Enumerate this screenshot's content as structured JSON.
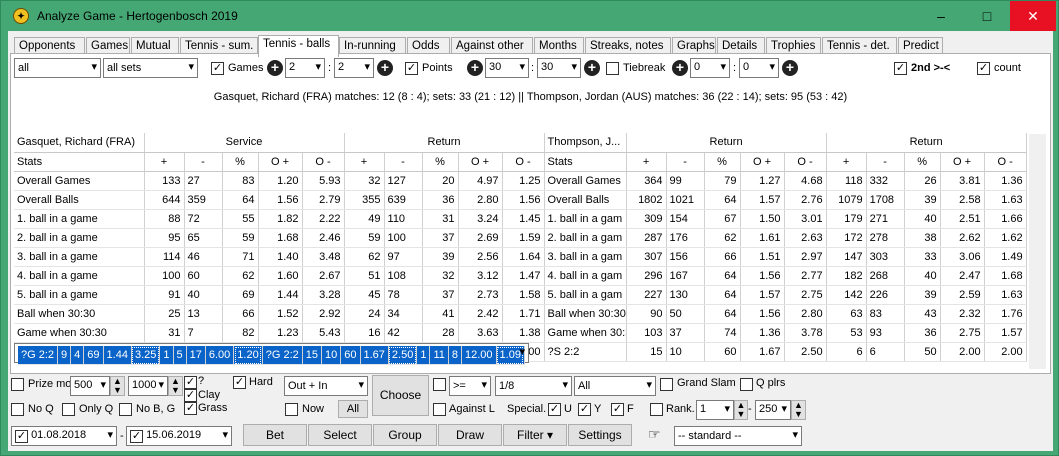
{
  "window": {
    "title": "Analyze Game - Hertogenbosch 2019",
    "minimize": "–",
    "maximize": "□",
    "close": "✕"
  },
  "tabs": [
    "Opponents",
    "Games",
    "Mutual",
    "Tennis - sum.",
    "Tennis - balls",
    "In-running",
    "Odds",
    "Against other",
    "Months",
    "Streaks, notes",
    "Graphs",
    "Details",
    "Trophies",
    "Tennis - det.",
    "Predict"
  ],
  "filters": {
    "all": "all",
    "sets": "all sets",
    "games_label": "Games",
    "games_a": "2",
    "games_b": "2",
    "points_label": "Points",
    "points_a": "30",
    "points_b": "30",
    "tiebreak_label": "Tiebreak",
    "tb_a": "0",
    "tb_b": "0",
    "second_label": "2nd >-<",
    "count_label": "count"
  },
  "summary": "Gasquet, Richard (FRA)  matches: 12 (8 : 4);  sets: 33 (21 : 12)   ||   Thompson, Jordan (AUS)  matches: 36 (22 : 14);  sets: 95 (53 : 42)",
  "header": {
    "p1": "Gasquet, Richard (FRA)",
    "service": "Service",
    "return": "Return",
    "p2": "Thompson, J...",
    "return2": "Return",
    "return3": "Return",
    "stats": "Stats",
    "cols": [
      "+",
      "-",
      "%",
      "O +",
      "O -"
    ]
  },
  "rows": [
    {
      "name": "Overall Games",
      "a": [
        "133",
        "27",
        "83",
        "1.20",
        "5.93"
      ],
      "b": [
        "32",
        "127",
        "20",
        "4.97",
        "1.25"
      ],
      "name2": "Overall Games",
      "c": [
        "364",
        "99",
        "79",
        "1.27",
        "4.68"
      ],
      "d": [
        "118",
        "332",
        "26",
        "3.81",
        "1.36"
      ]
    },
    {
      "name": "Overall Balls",
      "a": [
        "644",
        "359",
        "64",
        "1.56",
        "2.79"
      ],
      "b": [
        "355",
        "639",
        "36",
        "2.80",
        "1.56"
      ],
      "name2": "Overall Balls",
      "c": [
        "1802",
        "1021",
        "64",
        "1.57",
        "2.76"
      ],
      "d": [
        "1079",
        "1708",
        "39",
        "2.58",
        "1.63"
      ]
    },
    {
      "name": "1. ball in a game",
      "a": [
        "88",
        "72",
        "55",
        "1.82",
        "2.22"
      ],
      "b": [
        "49",
        "110",
        "31",
        "3.24",
        "1.45"
      ],
      "name2": "1. ball in a gam",
      "c": [
        "309",
        "154",
        "67",
        "1.50",
        "3.01"
      ],
      "d": [
        "179",
        "271",
        "40",
        "2.51",
        "1.66"
      ]
    },
    {
      "name": "2. ball in a game",
      "a": [
        "95",
        "65",
        "59",
        "1.68",
        "2.46"
      ],
      "b": [
        "59",
        "100",
        "37",
        "2.69",
        "1.59"
      ],
      "name2": "2. ball in a gam",
      "c": [
        "287",
        "176",
        "62",
        "1.61",
        "2.63"
      ],
      "d": [
        "172",
        "278",
        "38",
        "2.62",
        "1.62"
      ]
    },
    {
      "name": "3. ball in a game",
      "a": [
        "114",
        "46",
        "71",
        "1.40",
        "3.48"
      ],
      "b": [
        "62",
        "97",
        "39",
        "2.56",
        "1.64"
      ],
      "name2": "3. ball in a gam",
      "c": [
        "307",
        "156",
        "66",
        "1.51",
        "2.97"
      ],
      "d": [
        "147",
        "303",
        "33",
        "3.06",
        "1.49"
      ]
    },
    {
      "name": "4. ball in a game",
      "a": [
        "100",
        "60",
        "62",
        "1.60",
        "2.67"
      ],
      "b": [
        "51",
        "108",
        "32",
        "3.12",
        "1.47"
      ],
      "name2": "4. ball in a gam",
      "c": [
        "296",
        "167",
        "64",
        "1.56",
        "2.77"
      ],
      "d": [
        "182",
        "268",
        "40",
        "2.47",
        "1.68"
      ]
    },
    {
      "name": "5. ball in a game",
      "a": [
        "91",
        "40",
        "69",
        "1.44",
        "3.28"
      ],
      "b": [
        "45",
        "78",
        "37",
        "2.73",
        "1.58"
      ],
      "name2": "5. ball in a gam",
      "c": [
        "227",
        "130",
        "64",
        "1.57",
        "2.75"
      ],
      "d": [
        "142",
        "226",
        "39",
        "2.59",
        "1.63"
      ]
    },
    {
      "name": "Ball when 30:30",
      "a": [
        "25",
        "13",
        "66",
        "1.52",
        "2.92"
      ],
      "b": [
        "24",
        "34",
        "41",
        "2.42",
        "1.71"
      ],
      "name2": "Ball when 30:30",
      "c": [
        "90",
        "50",
        "64",
        "1.56",
        "2.80"
      ],
      "d": [
        "63",
        "83",
        "43",
        "2.32",
        "1.76"
      ]
    },
    {
      "name": "Game when 30:30",
      "a": [
        "31",
        "7",
        "82",
        "1.23",
        "5.43"
      ],
      "b": [
        "16",
        "42",
        "28",
        "3.63",
        "1.38"
      ],
      "name2": "Game when 30:3",
      "c": [
        "103",
        "37",
        "74",
        "1.36",
        "3.78"
      ],
      "d": [
        "53",
        "93",
        "36",
        "2.75",
        "1.57"
      ]
    },
    {
      "name": "?G 2:2",
      "a": [
        "9",
        "4",
        "69",
        "1.44",
        "3.25"
      ],
      "b": [
        "1",
        "5",
        "17",
        "6.00",
        "1.20"
      ],
      "name2": "?G 2:2",
      "c": [
        "15",
        "10",
        "60",
        "1.67",
        "2.50"
      ],
      "d": [
        "1",
        "11",
        "8",
        "12.00",
        "1.09"
      ]
    },
    {
      "name": "?S 2:2",
      "a": [
        "10",
        "3",
        "77",
        "1.30",
        "4.33"
      ],
      "b": [
        "3",
        "3",
        "50",
        "2.00",
        "2.00"
      ],
      "name2": "?S 2:2",
      "c": [
        "15",
        "10",
        "60",
        "1.67",
        "2.50"
      ],
      "d": [
        "6",
        "6",
        "50",
        "2.00",
        "2.00"
      ]
    }
  ],
  "bottom": {
    "prize_label": "Prize mo",
    "prize_min": "500",
    "prize_max": "1000",
    "q_label": "?",
    "clay_label": "Clay",
    "grass_label": "Grass",
    "hard_label": "Hard",
    "out_in": "Out + In",
    "now_label": "Now",
    "all_btn": "All",
    "choose_btn": "Choose",
    "op": ">=",
    "frac": "1/8",
    "all_sel": "All",
    "grand_slam": "Grand Slam",
    "q_plrs": "Q plrs",
    "no_q": "No Q",
    "only_q": "Only Q",
    "no_bg": "No B, G",
    "against_l": "Against L",
    "special": "Special.",
    "u": "U",
    "y": "Y",
    "f": "F",
    "rank": "Rank.",
    "rank_min": "1",
    "rank_max": "250",
    "date_from": "01.08.2018",
    "date_to": "15.06.2019",
    "bet": "Bet",
    "select": "Select",
    "group": "Group",
    "draw": "Draw",
    "filter": "Filter ▾",
    "settings": "Settings",
    "preset": "-- standard --"
  }
}
